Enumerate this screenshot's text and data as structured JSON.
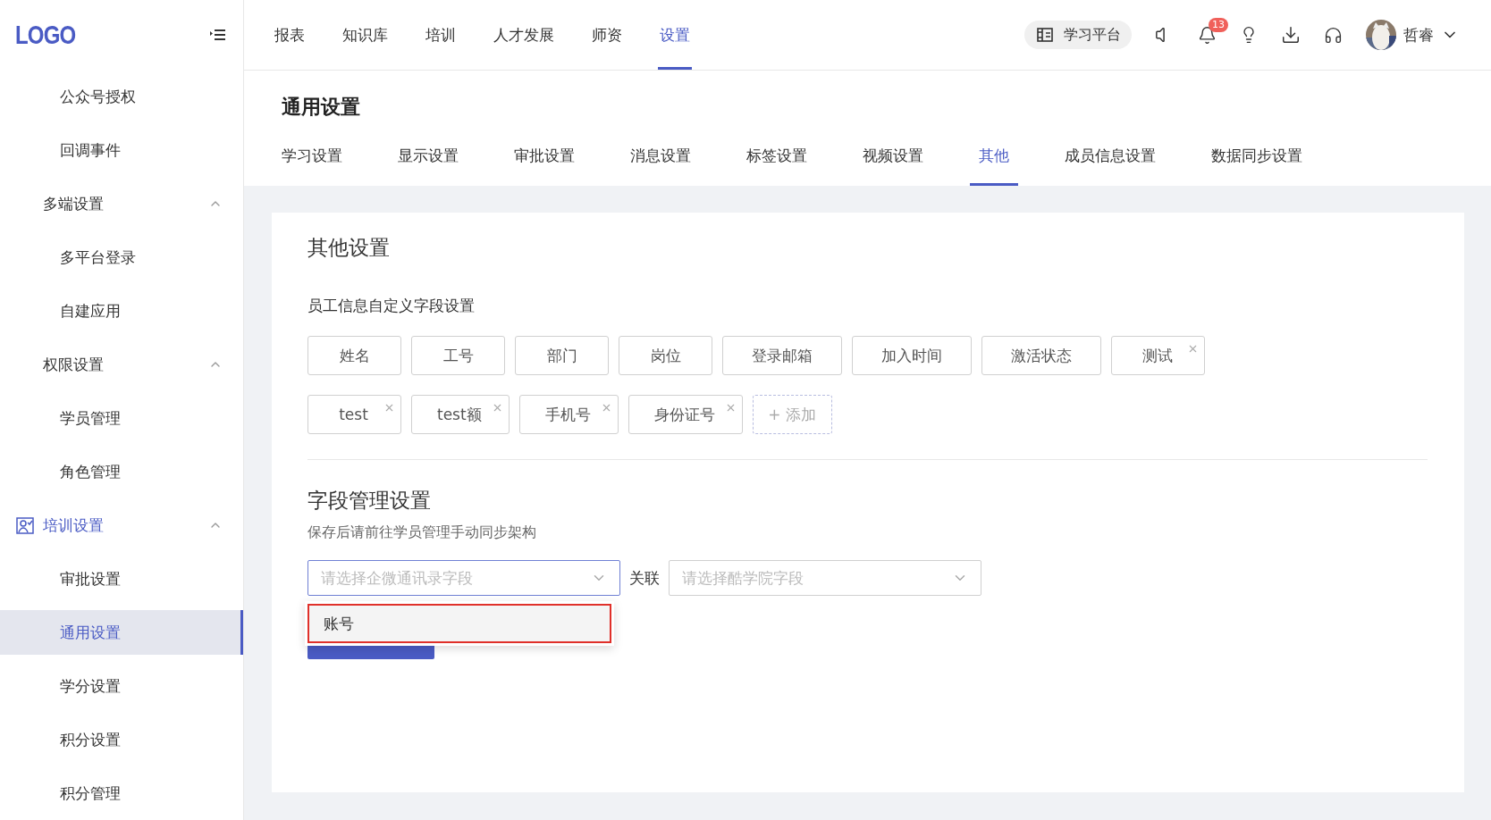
{
  "logo": "LOGO",
  "sidebar": {
    "items": [
      {
        "label": "公众号授权",
        "selected": false
      },
      {
        "label": "回调事件",
        "selected": false
      },
      {
        "label": "多端设置",
        "expanded": true,
        "active": false,
        "children": [
          {
            "label": "多平台登录",
            "selected": false
          },
          {
            "label": "自建应用",
            "selected": false
          }
        ]
      },
      {
        "label": "权限设置",
        "expanded": true,
        "active": false,
        "children": [
          {
            "label": "学员管理",
            "selected": false
          },
          {
            "label": "角色管理",
            "selected": false
          }
        ]
      },
      {
        "label": "培训设置",
        "expanded": true,
        "active": true,
        "children": [
          {
            "label": "审批设置",
            "selected": false
          },
          {
            "label": "通用设置",
            "selected": true
          },
          {
            "label": "学分设置",
            "selected": false
          },
          {
            "label": "积分设置",
            "selected": false
          },
          {
            "label": "积分管理",
            "selected": false
          }
        ]
      }
    ]
  },
  "nav": {
    "items": [
      {
        "label": "报表",
        "selected": false
      },
      {
        "label": "知识库",
        "selected": false
      },
      {
        "label": "培训",
        "selected": false
      },
      {
        "label": "人才发展",
        "selected": false
      },
      {
        "label": "师资",
        "selected": false
      },
      {
        "label": "设置",
        "selected": true
      }
    ]
  },
  "header_actions": {
    "platform_button": "学习平台",
    "notification_count": "13",
    "user_name": "哲睿"
  },
  "page": {
    "title": "通用设置",
    "tabs": [
      {
        "label": "学习设置",
        "selected": false
      },
      {
        "label": "显示设置",
        "selected": false
      },
      {
        "label": "审批设置",
        "selected": false
      },
      {
        "label": "消息设置",
        "selected": false
      },
      {
        "label": "标签设置",
        "selected": false
      },
      {
        "label": "视频设置",
        "selected": false
      },
      {
        "label": "其他",
        "selected": true
      },
      {
        "label": "成员信息设置",
        "selected": false
      },
      {
        "label": "数据同步设置",
        "selected": false
      }
    ]
  },
  "card": {
    "title": "其他设置",
    "custom_fields": {
      "heading": "员工信息自定义字段设置",
      "tags": [
        {
          "label": "姓名",
          "removable": false
        },
        {
          "label": "工号",
          "removable": false
        },
        {
          "label": "部门",
          "removable": false
        },
        {
          "label": "岗位",
          "removable": false
        },
        {
          "label": "登录邮箱",
          "removable": false
        },
        {
          "label": "加入时间",
          "removable": false
        },
        {
          "label": "激活状态",
          "removable": false
        },
        {
          "label": "测试",
          "removable": true
        },
        {
          "label": "test",
          "removable": true
        },
        {
          "label": "test额",
          "removable": true
        },
        {
          "label": "手机号",
          "removable": true
        },
        {
          "label": "身份证号",
          "removable": true
        }
      ],
      "add_button": "+ 添加"
    },
    "field_mapping": {
      "heading": "字段管理设置",
      "hint": "保存后请前往学员管理手动同步架构",
      "source_select": {
        "placeholder": "请选择企微通讯录字段",
        "focused": true
      },
      "link_label": "关联",
      "target_select": {
        "placeholder": "请选择酷学院字段",
        "focused": false
      },
      "dropdown": {
        "options": [
          {
            "label": "账号",
            "highlighted": true
          }
        ]
      }
    }
  }
}
